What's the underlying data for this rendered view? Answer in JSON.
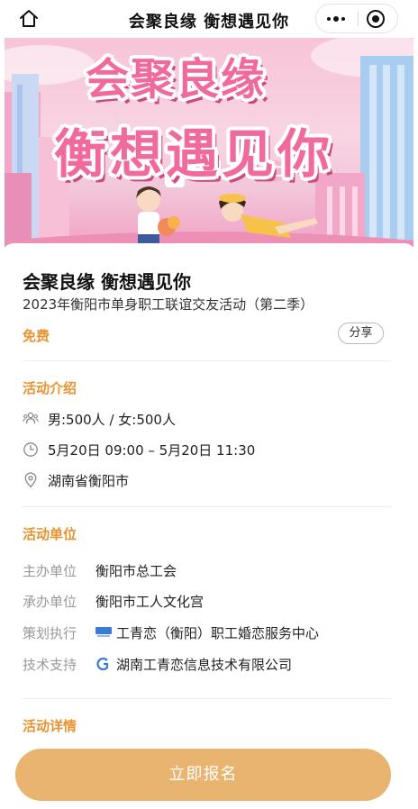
{
  "navbar": {
    "title": "会聚良缘 衡想遇见你",
    "home_icon": "home-icon",
    "more_icon": "more-dots-icon",
    "close_icon": "target-circle-icon"
  },
  "banner": {
    "line1": "会聚良缘",
    "line2": "衡想遇见你",
    "title_color": "#f06a9e"
  },
  "event": {
    "title": "会聚良缘 衡想遇见你",
    "subtitle": "2023年衡阳市单身职工联谊交友活动（第二季）",
    "price": "免费",
    "share_label": "分享"
  },
  "intro": {
    "heading": "活动介绍",
    "items": [
      {
        "icon": "people-icon",
        "text": "男:500人 / 女:500人"
      },
      {
        "icon": "clock-icon",
        "text": "5月20日 09:00 – 5月20日 11:30"
      },
      {
        "icon": "location-pin-icon",
        "text": "湖南省衡阳市"
      }
    ]
  },
  "organizers": {
    "heading": "活动单位",
    "rows": [
      {
        "label": "主办单位",
        "value": "衡阳市总工会"
      },
      {
        "label": "承办单位",
        "value": "衡阳市工人文化宫"
      },
      {
        "label": "策划执行",
        "value": "工青恋（衡阳）职工婚恋服务中心"
      },
      {
        "label": "技术支持",
        "value": "湖南工青恋信息技术有限公司"
      }
    ]
  },
  "details": {
    "heading": "活动详情"
  },
  "register": {
    "label": "立即报名"
  },
  "colors": {
    "accent": "#e9922f",
    "button": "#e9b46f",
    "muted": "#999999"
  }
}
